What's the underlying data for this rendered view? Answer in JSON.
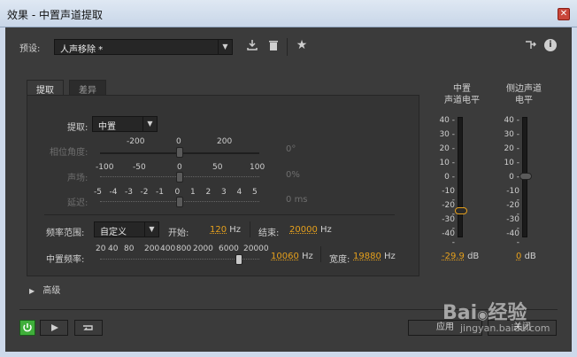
{
  "window": {
    "title": "效果 - 中置声道提取",
    "close_glyph": "✕"
  },
  "presets": {
    "label": "预设:",
    "value": "人声移除 *"
  },
  "tabs": [
    {
      "label": "提取"
    },
    {
      "label": "差异"
    }
  ],
  "extract": {
    "label": "提取:",
    "value": "中置"
  },
  "phase": {
    "label": "相位角度:",
    "ticks": [
      "-200",
      "0",
      "200"
    ],
    "value": "0",
    "unit": "°",
    "level": 0.5
  },
  "pan": {
    "label": "声场:",
    "ticks": [
      "-100",
      "-50",
      "0",
      "50",
      "100"
    ],
    "value": "0",
    "unit": "%",
    "level": 0.5
  },
  "delay": {
    "label": "延迟:",
    "ticks": [
      "-5",
      "-4",
      "-3",
      "-2",
      "-1",
      "0",
      "1",
      "2",
      "3",
      "4",
      "5"
    ],
    "value": "0",
    "unit": "ms",
    "level": 0.5
  },
  "freq_range": {
    "label": "频率范围:",
    "value": "自定义",
    "start_label": "开始:",
    "start_value": "120",
    "start_unit": "Hz",
    "end_label": "结束:",
    "end_value": "20000",
    "end_unit": "Hz"
  },
  "center_freq": {
    "label": "中置频率:",
    "ticks": [
      "20",
      "40",
      "80",
      "200",
      "400",
      "800",
      "2000",
      "6000",
      "20000"
    ],
    "value": "10060",
    "unit": "Hz",
    "level": 0.9,
    "width_label": "宽度:",
    "width_value": "19880",
    "width_unit": "Hz"
  },
  "advanced": {
    "label": "高级"
  },
  "meters": {
    "center": {
      "title1": "中置",
      "title2": "声道电平",
      "value": "-29.9",
      "unit": "dB",
      "level_db": -30
    },
    "side": {
      "title1": "侧边声道",
      "title2": "电平",
      "value": "0",
      "unit": "dB",
      "level_db": 0
    },
    "scale": [
      "40",
      "30",
      "20",
      "10",
      "0",
      "-10",
      "-20",
      "-30",
      "-40"
    ]
  },
  "footer": {
    "apply_label": "应用",
    "close_label": "关闭"
  },
  "watermark": {
    "brand": "Bai",
    "brand2": "经验",
    "url": "jingyan.baidu.com"
  },
  "colors": {
    "accent": "#e6a01c",
    "power": "#3fae3a"
  }
}
